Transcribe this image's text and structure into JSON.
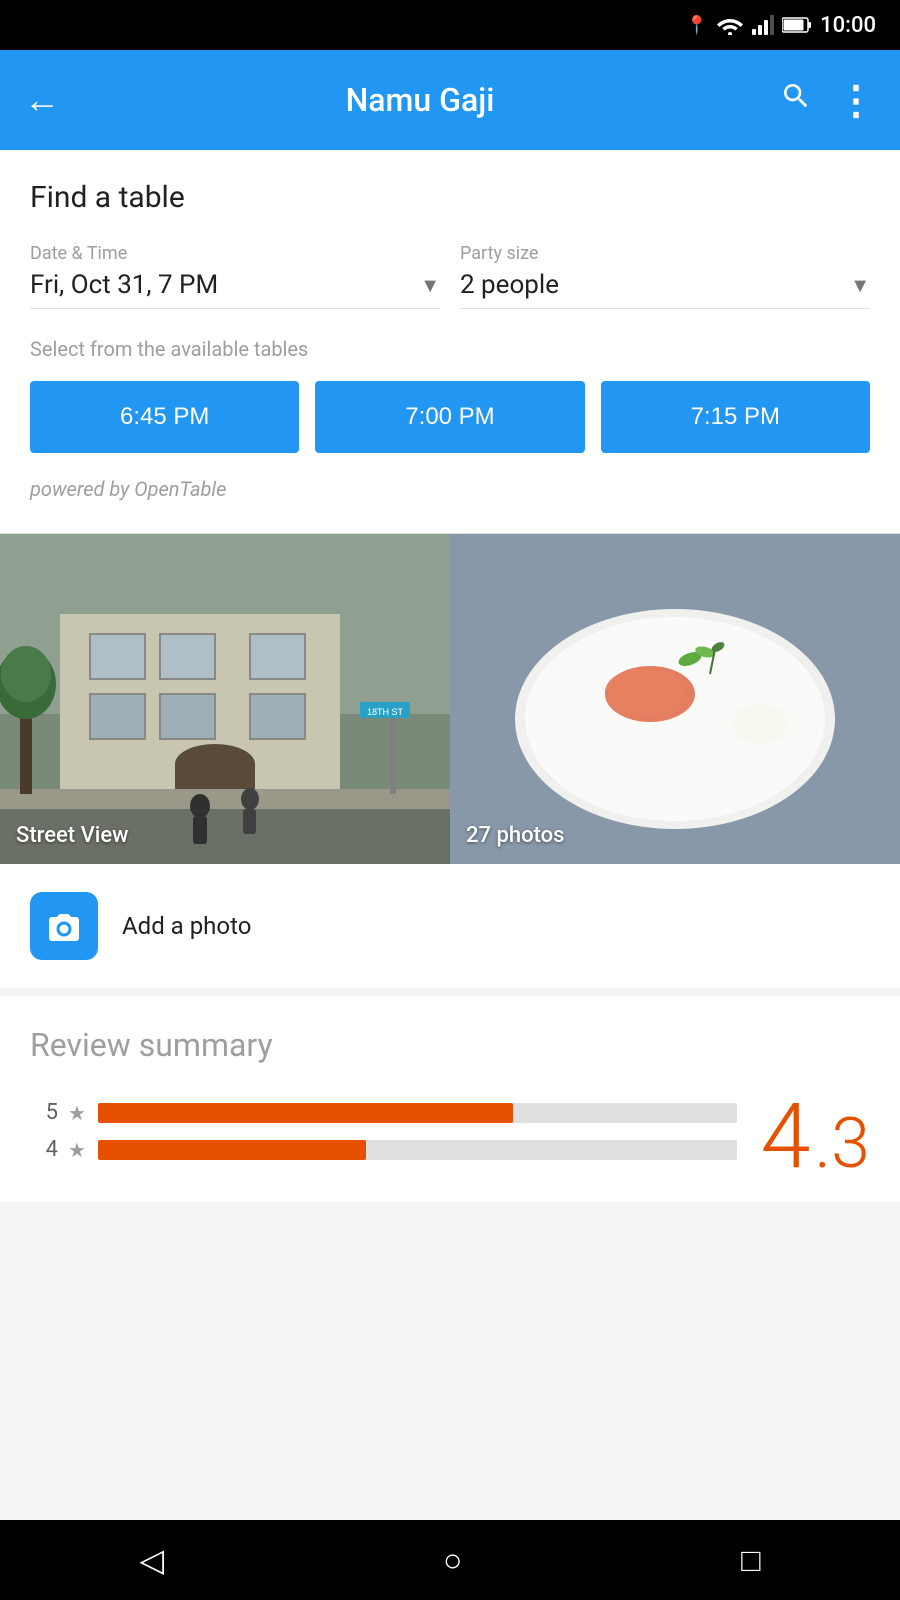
{
  "status_bar": {
    "time": "10:00"
  },
  "app_bar": {
    "title": "Namu Gaji",
    "back_label": "←",
    "search_label": "⌕",
    "more_label": "⋮"
  },
  "find_table": {
    "title": "Find a table",
    "date_time_label": "Date & Time",
    "date_time_value": "Fri, Oct 31, 7 PM",
    "party_size_label": "Party size",
    "party_size_value": "2 people",
    "available_tables_label": "Select from the available tables",
    "time_slots": [
      "6:45 PM",
      "7:00 PM",
      "7:15 PM"
    ],
    "powered_by": "powered by OpenTable"
  },
  "photos": {
    "street_view_label": "Street View",
    "photos_label": "27 photos"
  },
  "add_photo": {
    "label": "Add a photo"
  },
  "review_summary": {
    "title": "Review summary",
    "rating_score": "4",
    "rating_decimal": ".3",
    "bars": [
      {
        "star": "5",
        "width_pct": 65
      },
      {
        "star": "4",
        "width_pct": 42
      }
    ]
  },
  "nav_bar": {
    "back_icon": "◁",
    "home_icon": "○",
    "recent_icon": "□"
  }
}
